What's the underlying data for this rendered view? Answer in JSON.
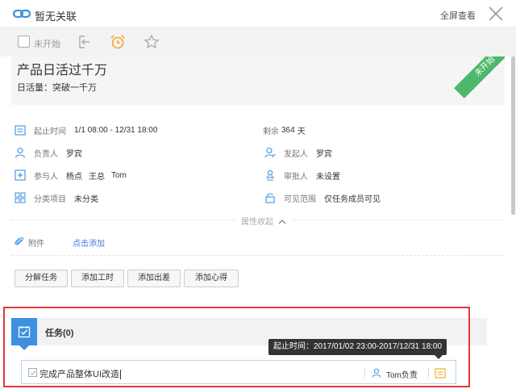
{
  "topbar": {
    "title": "暂无关联",
    "fullscreen_label": "全屏查看",
    "icons": {
      "link": "link-icon",
      "close": "close-icon"
    }
  },
  "toolbar": {
    "status_label": "未开始",
    "icons": [
      "exit-icon",
      "alarm-clock-icon",
      "star-icon"
    ],
    "accent": "#f5a623"
  },
  "task": {
    "title": "产品日活过千万",
    "subtitle": "日活量：突破一千万",
    "ribbon": "未开始",
    "ribbon_color": "#4db86a"
  },
  "details": {
    "time_label": "起止时间",
    "time_value": "1/1 08:00 - 12/31 18:00",
    "remaining_prefix": "剩余",
    "remaining_days": "364",
    "remaining_suffix": "天",
    "owner_label": "负责人",
    "owner_value": "罗宾",
    "creator_label": "发起人",
    "creator_value": "罗宾",
    "participants_label": "参与人",
    "participants": [
      "杨点",
      "王总",
      "Tom"
    ],
    "approver_label": "审批人",
    "approver_value": "未设置",
    "category_label": "分类项目",
    "category_value": "未分类",
    "visibility_label": "可见范围",
    "visibility_value": "仅任务成员可见",
    "collapse_label": "属性收起"
  },
  "attachments": {
    "label": "附件",
    "add_label": "点击添加"
  },
  "actions": [
    "分解任务",
    "添加工时",
    "添加出差",
    "添加心得"
  ],
  "subtasks": {
    "title": "任务(0)",
    "tooltip": "起止时间：2017/01/02 23:00-2017/12/31 18:00",
    "new_task_text": "完成产品整体UI改造",
    "owner_text": "Tom负责",
    "highlight_color": "#e03b3b",
    "badge_color": "#3d8fe0"
  }
}
